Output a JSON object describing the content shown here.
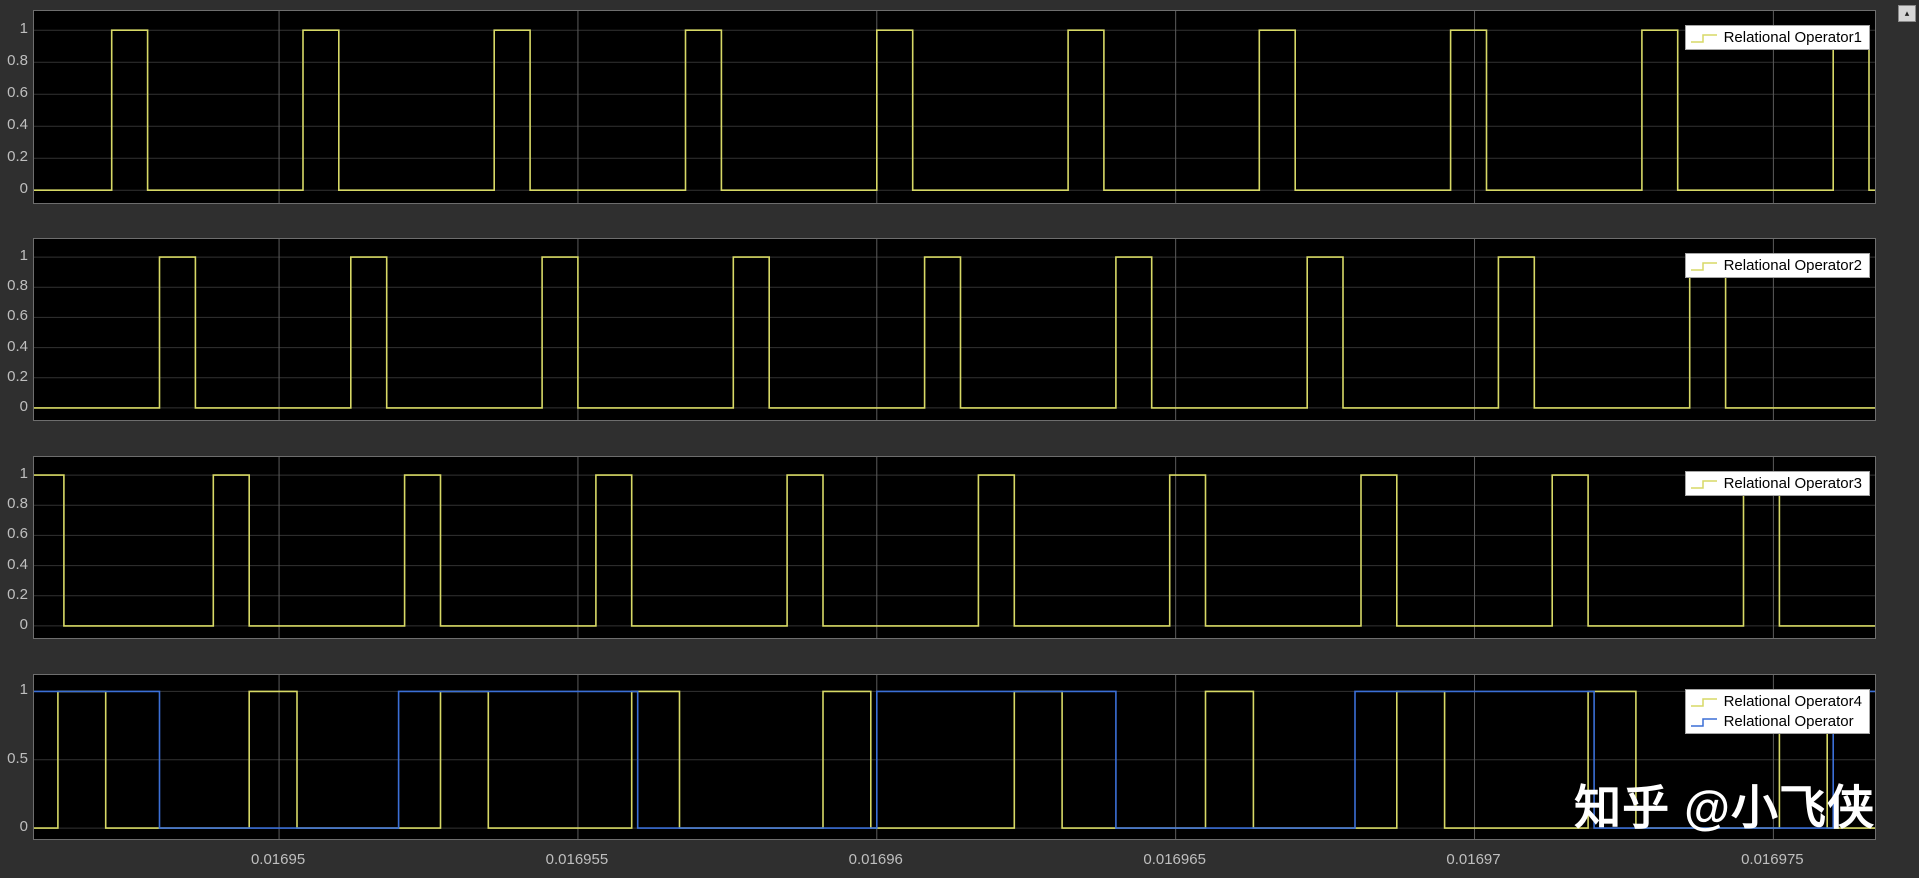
{
  "window": {
    "background": "#2f2f2f",
    "restore_icon": "▴"
  },
  "watermark": {
    "text": "知乎 @小飞侠",
    "color": "#ffffff"
  },
  "colors": {
    "plot_bg": "#000000",
    "axes_border": "#6e6e6e",
    "grid_h": "#333333",
    "grid_v": "#5c5c5c",
    "tick_label": "#bfbfbf",
    "legend_bg": "#ffffff",
    "legend_border": "#a6a6a6",
    "legend_text": "#000000",
    "series_yellow": "#d7d966",
    "series_blue": "#3b6fd6"
  },
  "axis": {
    "tmin": 0.0169459,
    "tmax": 0.0169767,
    "ylim": [
      -0.08,
      1.12
    ],
    "x_ticks": [
      {
        "v": 0.01695,
        "label": "0.01695"
      },
      {
        "v": 0.016955,
        "label": "0.016955"
      },
      {
        "v": 0.01696,
        "label": "0.01696"
      },
      {
        "v": 0.016965,
        "label": "0.016965"
      },
      {
        "v": 0.01697,
        "label": "0.01697"
      },
      {
        "v": 0.016975,
        "label": "0.016975"
      }
    ]
  },
  "chart_data": [
    {
      "type": "line",
      "waveform": "digital-square",
      "title": "",
      "xlim": [
        0.0169459,
        0.0169767
      ],
      "ylim": [
        -0.08,
        1.12
      ],
      "grid": true,
      "legend_position": "top-right",
      "y_ticks": [
        {
          "v": 1,
          "label": "1"
        },
        {
          "v": 0.8,
          "label": "0.8"
        },
        {
          "v": 0.6,
          "label": "0.6"
        },
        {
          "v": 0.4,
          "label": "0.4"
        },
        {
          "v": 0.2,
          "label": "0.2"
        },
        {
          "v": 0,
          "label": "0"
        }
      ],
      "series": [
        {
          "name": "Relational Operator1",
          "color": "#d7d966",
          "initial": 0,
          "toggle_times": [
            0.0169472,
            0.0169478,
            0.0169504,
            0.016951,
            0.0169536,
            0.0169542,
            0.0169568,
            0.0169574,
            0.01696,
            0.0169606,
            0.0169632,
            0.0169638,
            0.0169664,
            0.016967,
            0.0169696,
            0.0169702,
            0.0169728,
            0.0169734,
            0.016976,
            0.0169766
          ]
        }
      ]
    },
    {
      "type": "line",
      "waveform": "digital-square",
      "title": "",
      "xlim": [
        0.0169459,
        0.0169767
      ],
      "ylim": [
        -0.08,
        1.12
      ],
      "grid": true,
      "legend_position": "top-right",
      "y_ticks": [
        {
          "v": 1,
          "label": "1"
        },
        {
          "v": 0.8,
          "label": "0.8"
        },
        {
          "v": 0.6,
          "label": "0.6"
        },
        {
          "v": 0.4,
          "label": "0.4"
        },
        {
          "v": 0.2,
          "label": "0.2"
        },
        {
          "v": 0,
          "label": "0"
        }
      ],
      "series": [
        {
          "name": "Relational Operator2",
          "color": "#d7d966",
          "initial": 0,
          "toggle_times": [
            0.016948,
            0.0169486,
            0.0169512,
            0.0169518,
            0.0169544,
            0.016955,
            0.0169576,
            0.0169582,
            0.0169608,
            0.0169614,
            0.016964,
            0.0169646,
            0.0169672,
            0.0169678,
            0.0169704,
            0.016971,
            0.0169736,
            0.0169742
          ]
        }
      ]
    },
    {
      "type": "line",
      "waveform": "digital-square",
      "title": "",
      "xlim": [
        0.0169459,
        0.0169767
      ],
      "ylim": [
        -0.08,
        1.12
      ],
      "grid": true,
      "legend_position": "top-right",
      "y_ticks": [
        {
          "v": 1,
          "label": "1"
        },
        {
          "v": 0.8,
          "label": "0.8"
        },
        {
          "v": 0.6,
          "label": "0.6"
        },
        {
          "v": 0.4,
          "label": "0.4"
        },
        {
          "v": 0.2,
          "label": "0.2"
        },
        {
          "v": 0,
          "label": "0"
        }
      ],
      "series": [
        {
          "name": "Relational Operator3",
          "color": "#d7d966",
          "initial": 1,
          "toggle_times": [
            0.0169464,
            0.0169489,
            0.0169495,
            0.0169521,
            0.0169527,
            0.0169553,
            0.0169559,
            0.0169585,
            0.0169591,
            0.0169617,
            0.0169623,
            0.0169649,
            0.0169655,
            0.0169681,
            0.0169687,
            0.0169713,
            0.0169719,
            0.0169745,
            0.0169751
          ]
        }
      ]
    },
    {
      "type": "line",
      "waveform": "digital-square",
      "title": "",
      "xlim": [
        0.0169459,
        0.0169767
      ],
      "ylim": [
        -0.08,
        1.12
      ],
      "grid": true,
      "legend_position": "top-right",
      "y_ticks": [
        {
          "v": 1,
          "label": "1"
        },
        {
          "v": 0.5,
          "label": "0.5"
        },
        {
          "v": 0,
          "label": "0"
        }
      ],
      "series": [
        {
          "name": "Relational Operator4",
          "color": "#d7d966",
          "initial": 0,
          "toggle_times": [
            0.0169463,
            0.0169471,
            0.0169495,
            0.0169503,
            0.0169527,
            0.0169535,
            0.0169559,
            0.0169567,
            0.0169591,
            0.0169599,
            0.0169623,
            0.0169631,
            0.0169655,
            0.0169663,
            0.0169687,
            0.0169695,
            0.0169719,
            0.0169727,
            0.0169751,
            0.0169759
          ]
        },
        {
          "name": "Relational Operator",
          "color": "#3b6fd6",
          "initial": 1,
          "toggle_times": [
            0.016948,
            0.016952,
            0.016956,
            0.01696,
            0.016964,
            0.016968,
            0.016972,
            0.016976
          ]
        }
      ]
    }
  ]
}
